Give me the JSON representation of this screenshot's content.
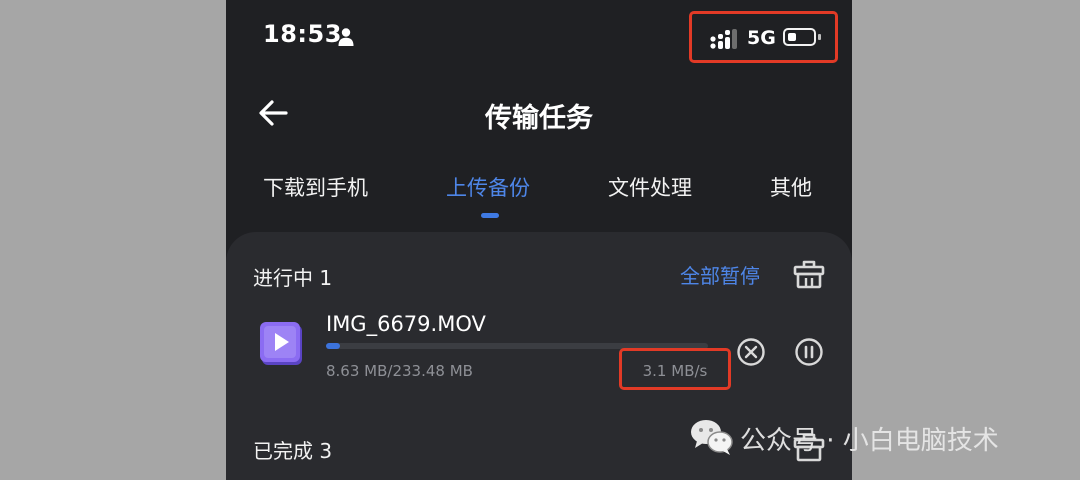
{
  "status_bar": {
    "time": "18:53",
    "network": "5G",
    "battery_level": 0.3,
    "icons": [
      "person-icon",
      "signal-icon",
      "battery-icon"
    ]
  },
  "header": {
    "title": "传输任务",
    "back_icon": "back-arrow-icon"
  },
  "tabs": [
    {
      "label": "下载到手机",
      "active": false
    },
    {
      "label": "上传备份",
      "active": true
    },
    {
      "label": "文件处理",
      "active": false
    },
    {
      "label": "其他",
      "active": false
    }
  ],
  "in_progress": {
    "title": "进行中 1",
    "pause_all_label": "全部暂停",
    "clear_icon": "trash-icon",
    "items": [
      {
        "file_name": "IMG_6679.MOV",
        "size_progress": "8.63 MB/233.48 MB",
        "progress_fraction": 0.037,
        "speed": "3.1 MB/s",
        "thumb_icon": "video-file-icon",
        "cancel_icon": "cancel-icon",
        "pause_icon": "pause-icon"
      }
    ]
  },
  "completed": {
    "title": "已完成 3",
    "clear_icon": "trash-icon"
  },
  "watermark": {
    "text": "公众号 · 小白电脑技术",
    "icon": "wechat-icon"
  },
  "colors": {
    "accent": "#4e86e8",
    "highlight_box": "#e23a26",
    "background": "#1f2023",
    "sheet": "#2a2b2f"
  }
}
